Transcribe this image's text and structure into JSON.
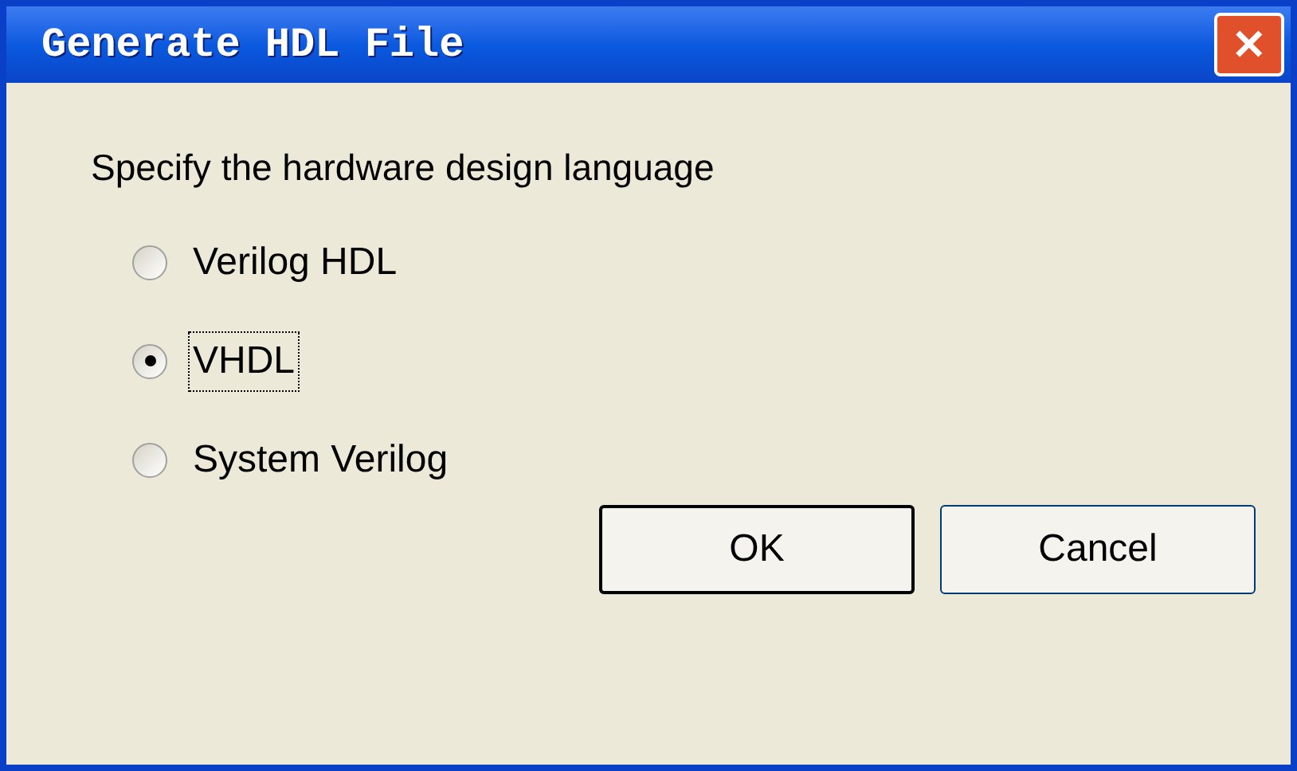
{
  "window": {
    "title": "Generate HDL File",
    "close": "✕"
  },
  "prompt": "Specify the hardware design language",
  "options": [
    {
      "label": "Verilog HDL",
      "selected": false
    },
    {
      "label": "VHDL",
      "selected": true
    },
    {
      "label": "System Verilog",
      "selected": false
    }
  ],
  "buttons": [
    "OK",
    "Cancel"
  ]
}
